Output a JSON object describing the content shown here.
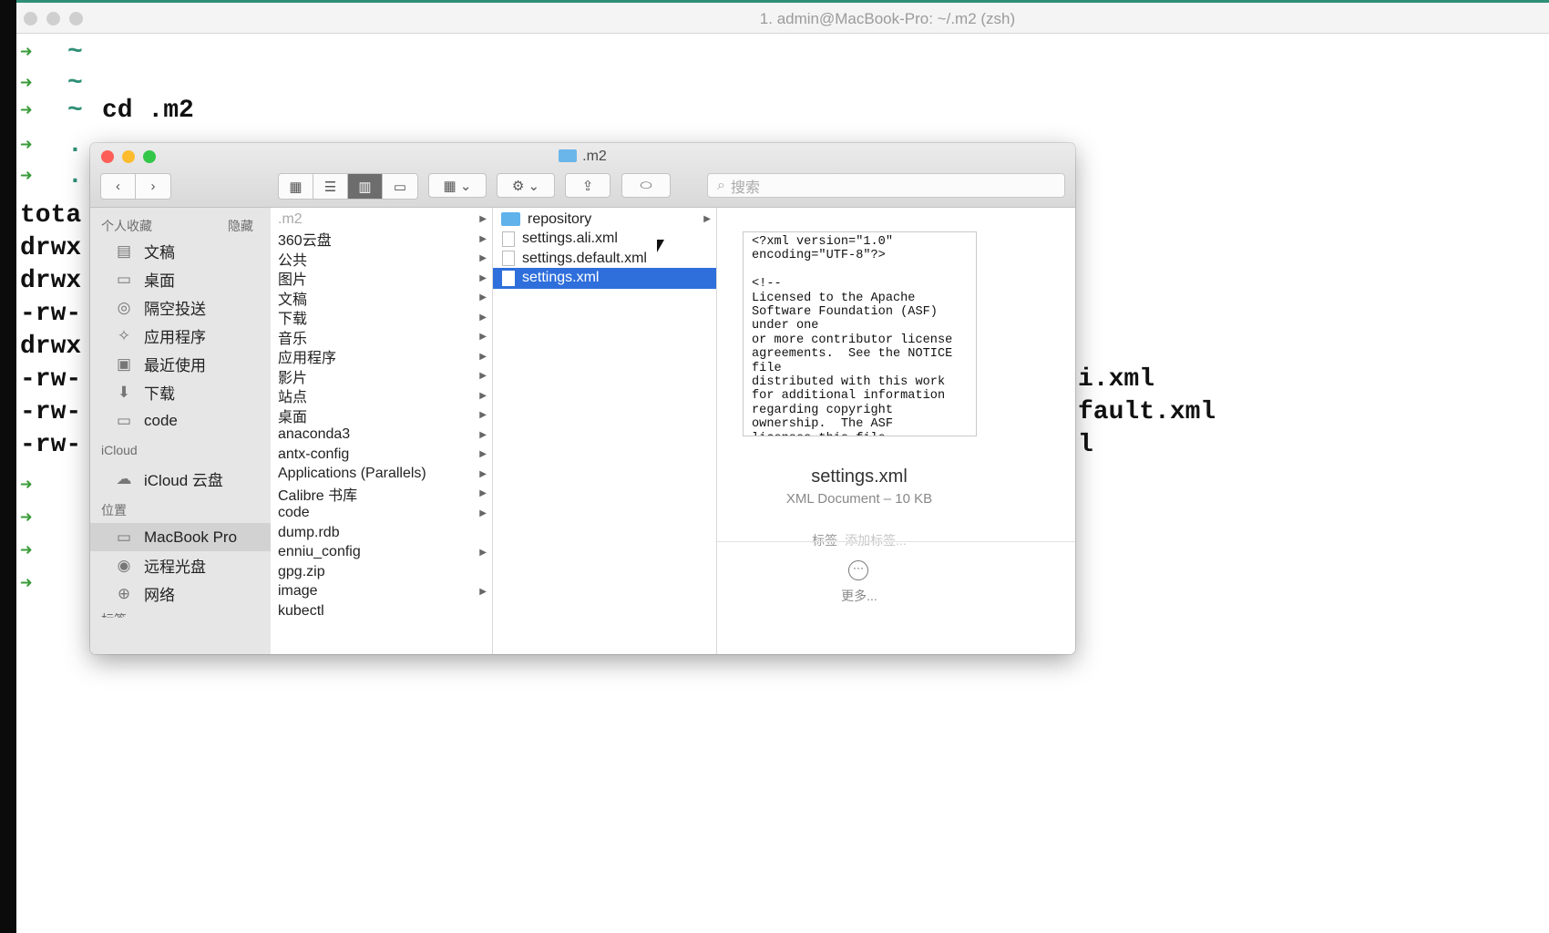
{
  "terminal": {
    "title": "1. admin@MacBook-Pro: ~/.m2 (zsh)",
    "prompt_arrow": "➜",
    "tilde": "~",
    "command": "cd .m2",
    "ls_left": [
      "tota",
      "drwx",
      "drwx",
      "-rw-",
      "drwx",
      "-rw-",
      "-rw-",
      "-rw-"
    ],
    "ls_right": [
      "i.xml",
      "fault.xml",
      "l"
    ],
    "dot": "."
  },
  "finder": {
    "title": ".m2",
    "search_placeholder": "搜索",
    "sidebar": {
      "favorites_header": "个人收藏",
      "hide_label": "隐藏",
      "favorites": [
        {
          "label": "文稿",
          "icon": "document-icon"
        },
        {
          "label": "桌面",
          "icon": "desktop-icon"
        },
        {
          "label": "隔空投送",
          "icon": "airdrop-icon"
        },
        {
          "label": "应用程序",
          "icon": "applications-icon"
        },
        {
          "label": "最近使用",
          "icon": "recents-icon"
        },
        {
          "label": "下载",
          "icon": "download-icon"
        },
        {
          "label": "code",
          "icon": "folder-icon"
        }
      ],
      "icloud_header": "iCloud",
      "icloud": [
        {
          "label": "iCloud 云盘",
          "icon": "cloud-icon"
        }
      ],
      "locations_header": "位置",
      "locations": [
        {
          "label": "MacBook Pro",
          "icon": "laptop-icon"
        },
        {
          "label": "远程光盘",
          "icon": "disc-icon"
        },
        {
          "label": "网络",
          "icon": "network-icon"
        }
      ],
      "tags_header": "标签"
    },
    "column1": [
      {
        "label": ".m2",
        "chevron": true
      },
      {
        "label": "360云盘",
        "chevron": true
      },
      {
        "label": "公共",
        "chevron": true
      },
      {
        "label": "图片",
        "chevron": true
      },
      {
        "label": "文稿",
        "chevron": true
      },
      {
        "label": "下载",
        "chevron": true
      },
      {
        "label": "音乐",
        "chevron": true
      },
      {
        "label": "应用程序",
        "chevron": true
      },
      {
        "label": "影片",
        "chevron": true
      },
      {
        "label": "站点",
        "chevron": true
      },
      {
        "label": "桌面",
        "chevron": true
      },
      {
        "label": "anaconda3",
        "chevron": true
      },
      {
        "label": "antx-config",
        "chevron": true
      },
      {
        "label": "Applications (Parallels)",
        "chevron": true
      },
      {
        "label": "Calibre 书库",
        "chevron": true
      },
      {
        "label": "code",
        "chevron": true
      },
      {
        "label": "dump.rdb",
        "chevron": false
      },
      {
        "label": "enniu_config",
        "chevron": true
      },
      {
        "label": "gpg.zip",
        "chevron": false
      },
      {
        "label": "image",
        "chevron": true
      },
      {
        "label": "kubectl",
        "chevron": false
      }
    ],
    "column2": [
      {
        "label": "repository",
        "type": "folder"
      },
      {
        "label": "settings.ali.xml",
        "type": "file"
      },
      {
        "label": "settings.default.xml",
        "type": "file"
      },
      {
        "label": "settings.xml",
        "type": "file"
      }
    ],
    "preview": {
      "content": "<?xml version=\"1.0\"\nencoding=\"UTF-8\"?>\n\n<!--\nLicensed to the Apache\nSoftware Foundation (ASF)\nunder one\nor more contributor license\nagreements.  See the NOTICE\nfile\ndistributed with this work\nfor additional information\nregarding copyright\nownership.  The ASF\nlicenses this file",
      "filename": "settings.xml",
      "kind": "XML Document – 10 KB",
      "tags_label": "标签",
      "tags_placeholder": "添加标签...",
      "more_label": "更多..."
    }
  },
  "colors": {
    "accent": "#2f6fdc",
    "close": "#fc5f57",
    "minimize": "#fdbc2e",
    "zoom": "#33c748",
    "prompt_green": "#3a9b3a"
  }
}
